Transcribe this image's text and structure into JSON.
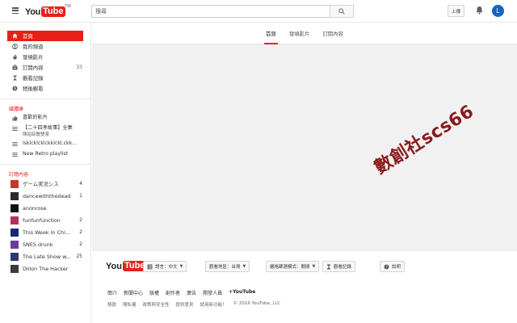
{
  "masthead": {
    "logo_you": "You",
    "logo_tube": "Tube",
    "region": "TW",
    "search_placeholder": "搜尋",
    "upload_label": "上傳",
    "avatar_letter": "L"
  },
  "sidebar": {
    "main_items": [
      {
        "icon": "home-icon",
        "label": "首頁",
        "count": ""
      },
      {
        "icon": "my-channel-icon",
        "label": "我的頻道",
        "count": ""
      },
      {
        "icon": "trending-icon",
        "label": "發燒影片",
        "count": ""
      },
      {
        "icon": "subscriptions-icon",
        "label": "訂閱內容",
        "count": "33"
      },
      {
        "icon": "history-icon",
        "label": "觀看記錄",
        "count": ""
      },
      {
        "icon": "watch-later-icon",
        "label": "稍後觀看",
        "count": ""
      }
    ],
    "library_title": "媒體庫",
    "library_items": [
      {
        "icon": "thumbs-up-icon",
        "label": "喜歡的影片",
        "sub": ""
      },
      {
        "icon": "playlist-icon",
        "label": "【二十四孝故事】全集",
        "sub": "陳紹綜醫雙靈"
      },
      {
        "icon": "playlist-icon",
        "label": "lsklcklcklckklckl,ckk...",
        "sub": ""
      },
      {
        "icon": "playlist-icon",
        "label": "New Retro playlist",
        "sub": ""
      }
    ],
    "subs_title": "訂閱內容",
    "subs": [
      {
        "label": "ゲーム実況シス",
        "count": "4",
        "color": "#c0392b"
      },
      {
        "label": "dancewiththedead",
        "count": "1",
        "color": "#2c2c2c"
      },
      {
        "label": "anonrose",
        "count": "",
        "color": "#111111"
      },
      {
        "label": "funfunfunction",
        "count": "2",
        "color": "#b03060"
      },
      {
        "label": "This Week In Chi...",
        "count": "2",
        "color": "#1a2a6c"
      },
      {
        "label": "SNES drunk",
        "count": "2",
        "color": "#6a3d9a"
      },
      {
        "label": "The Late Show w...",
        "count": "25",
        "color": "#2b3a67"
      },
      {
        "label": "Dillon The Hacker",
        "count": "",
        "color": "#3b3b3b"
      }
    ]
  },
  "tabs": [
    {
      "label": "首頁",
      "active": true
    },
    {
      "label": "發燒影片",
      "active": false
    },
    {
      "label": "訂閱內容",
      "active": false
    }
  ],
  "watermark": "數創社scs66",
  "footer": {
    "logo_you": "You",
    "logo_tube": "Tube",
    "language_btn": "語言：中文",
    "location_btn": "觀看地區：台灣",
    "restricted_btn": "嚴格篩選模式：關閉",
    "history_btn": "觀看記錄",
    "help_btn": "說明",
    "links_row1": [
      "簡介",
      "新聞中心",
      "版權",
      "創作者",
      "廣告",
      "開發人員",
      "+YouTube"
    ],
    "links_row2": [
      "條款",
      "隱私權",
      "政策與安全性",
      "提供意見",
      "試用新功能！",
      "© 2016 YouTube, LLC"
    ]
  }
}
